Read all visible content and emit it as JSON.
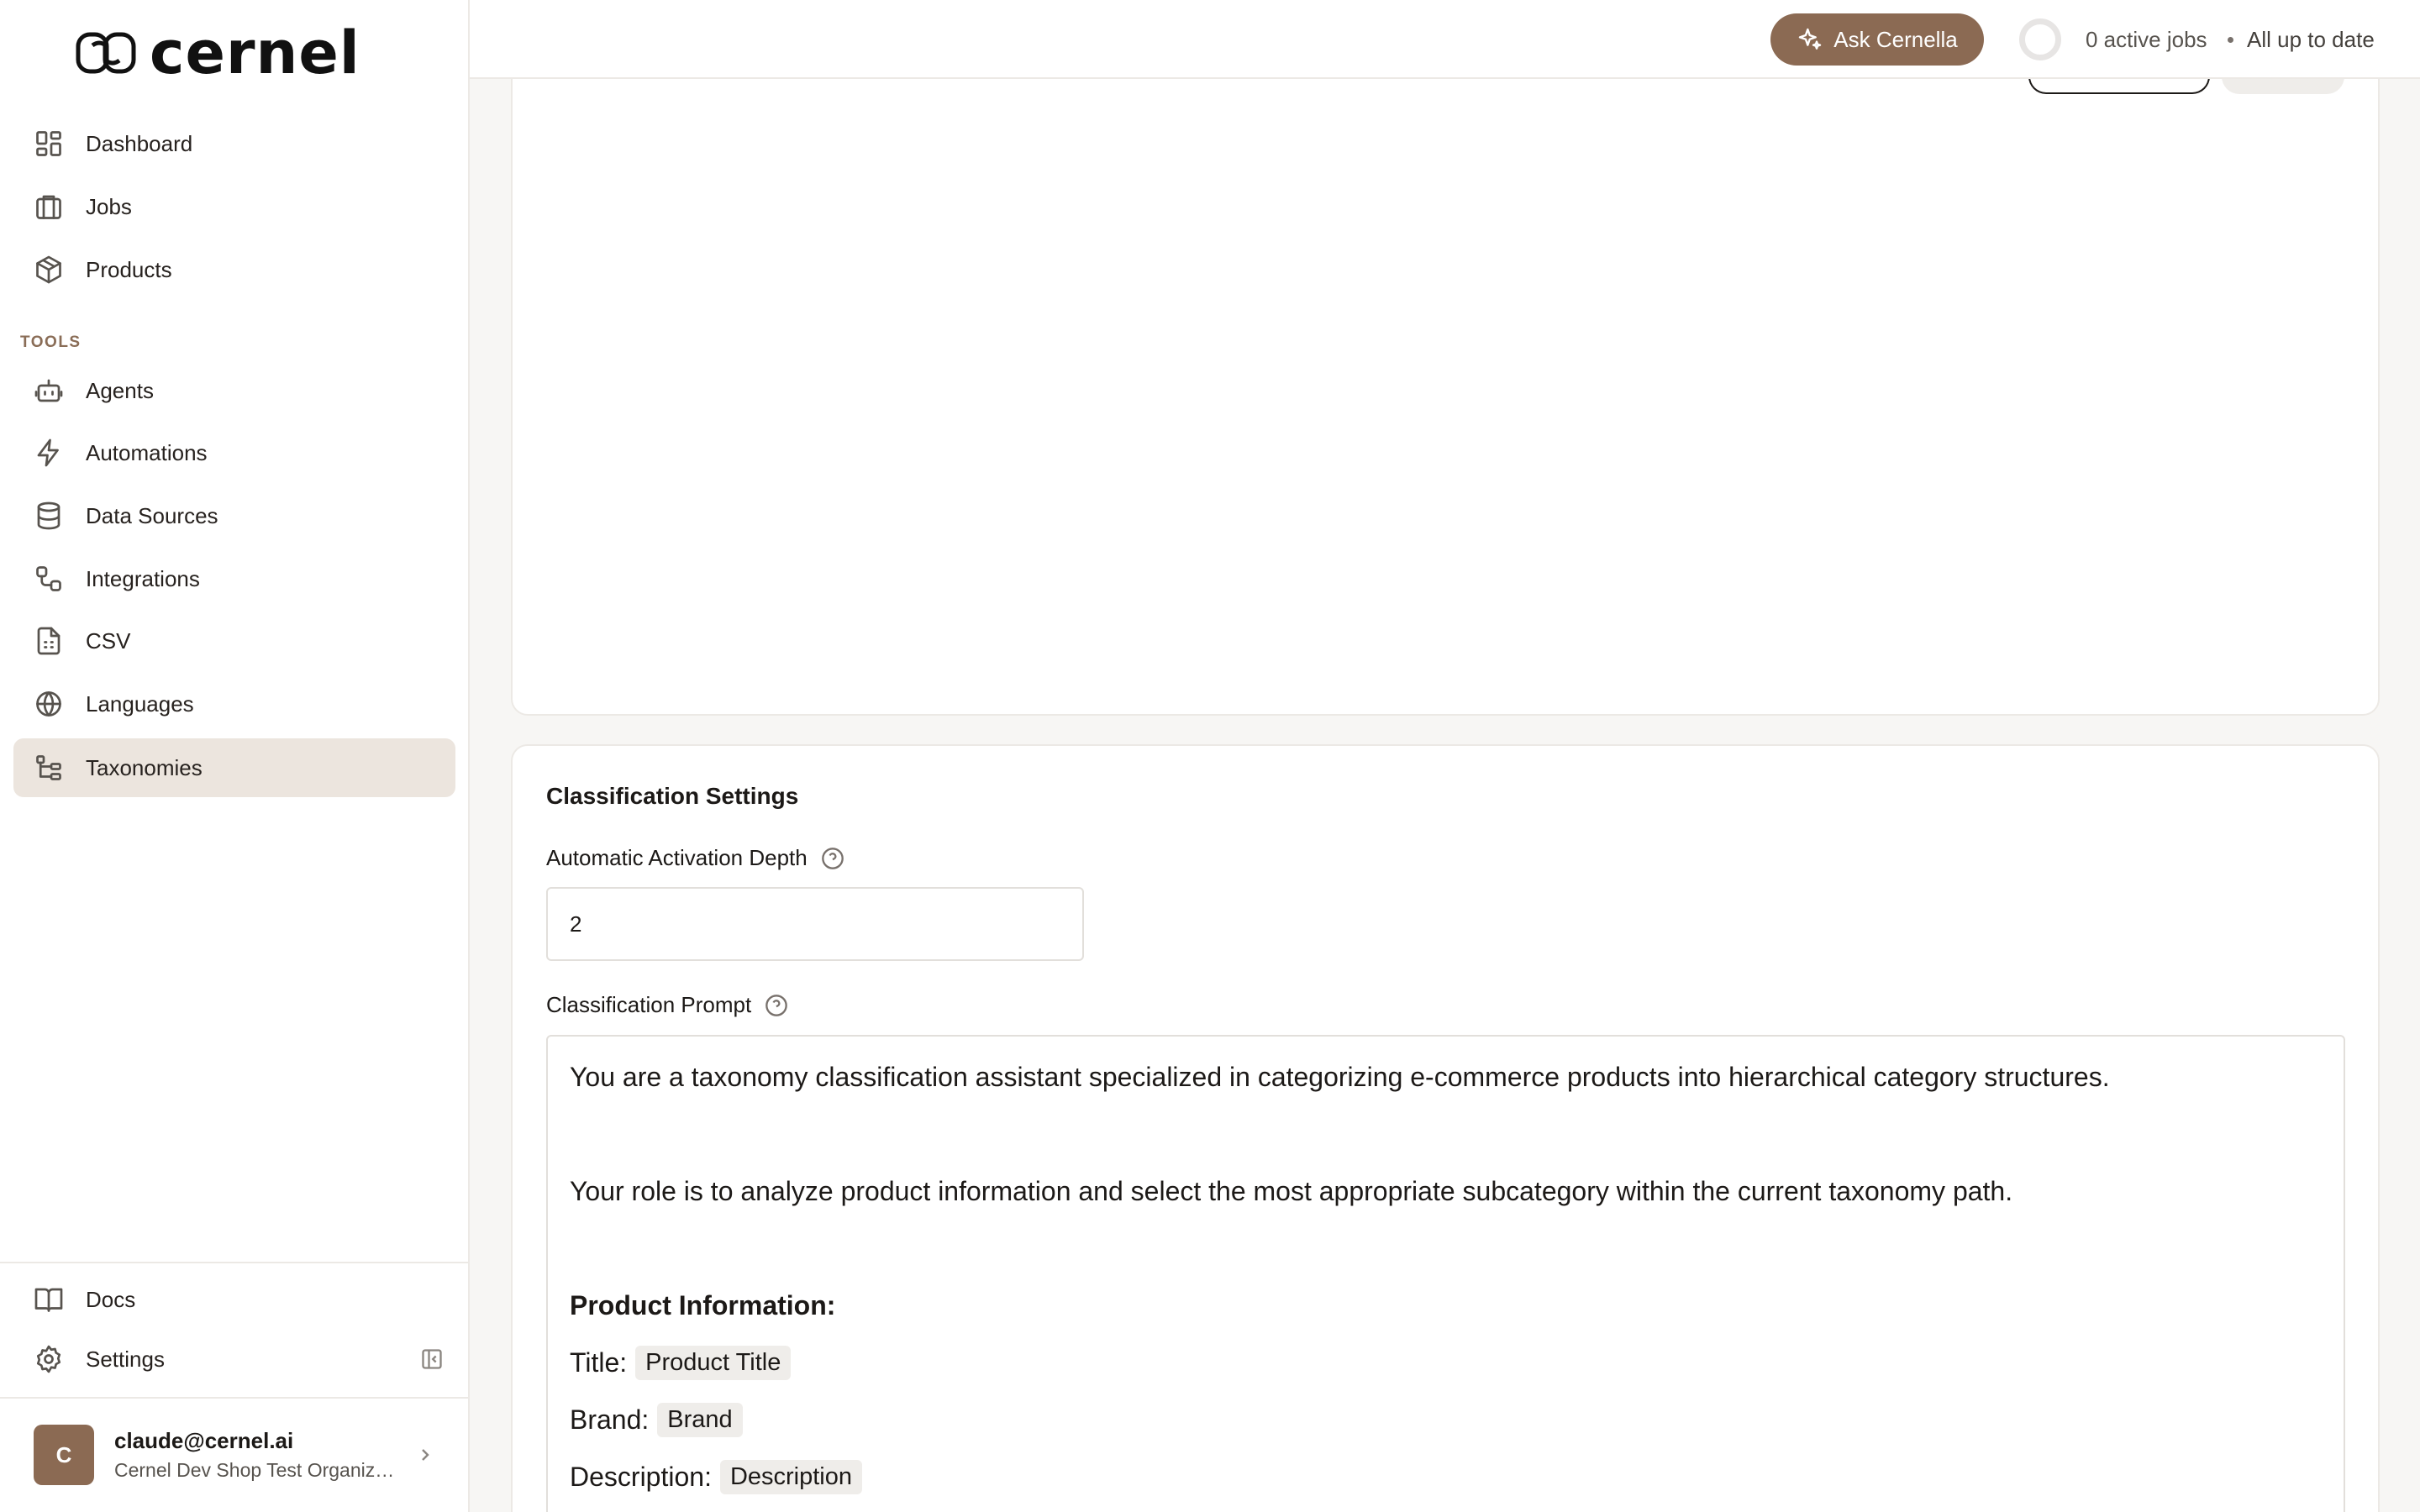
{
  "app": {
    "logo_text": "cernel"
  },
  "sidebar": {
    "items": [
      {
        "label": "Dashboard",
        "icon": "dashboard-icon"
      },
      {
        "label": "Jobs",
        "icon": "jobs-icon"
      },
      {
        "label": "Products",
        "icon": "products-icon"
      }
    ],
    "tools_label": "TOOLS",
    "tools": [
      {
        "label": "Agents",
        "icon": "robot-icon"
      },
      {
        "label": "Automations",
        "icon": "lightning-icon"
      },
      {
        "label": "Data Sources",
        "icon": "database-icon"
      },
      {
        "label": "Integrations",
        "icon": "integrations-icon"
      },
      {
        "label": "CSV",
        "icon": "csv-file-icon"
      },
      {
        "label": "Languages",
        "icon": "globe-icon"
      },
      {
        "label": "Taxonomies",
        "icon": "tree-icon",
        "active": true
      }
    ],
    "bottom": [
      {
        "label": "Docs",
        "icon": "book-icon"
      },
      {
        "label": "Settings",
        "icon": "gear-icon"
      }
    ],
    "user": {
      "initial": "C",
      "email": "claude@cernel.ai",
      "org": "Cernel Dev Shop Test Organization"
    }
  },
  "topbar": {
    "ask_label": "Ask Cernella",
    "active_jobs": "0 active jobs",
    "sync_status": "All up to date"
  },
  "settings": {
    "title": "Classification Settings",
    "depth_label": "Automatic Activation Depth",
    "depth_value": "2",
    "prompt_label": "Classification Prompt",
    "prompt": {
      "line1": "You are a taxonomy classification assistant specialized in categorizing e-commerce products into hierarchical category structures.",
      "line2": "Your role is to analyze product information and select the most appropriate subcategory within the current taxonomy path.",
      "heading": "Product Information:",
      "fields": [
        {
          "label": "Title:",
          "chip": "Product Title"
        },
        {
          "label": "Brand:",
          "chip": "Brand"
        },
        {
          "label": "Description:",
          "chip": "Description"
        }
      ]
    }
  },
  "colors": {
    "brand": "#8b6a53",
    "active_nav_bg": "#ece5de",
    "page_bg": "#f7f6f4"
  }
}
